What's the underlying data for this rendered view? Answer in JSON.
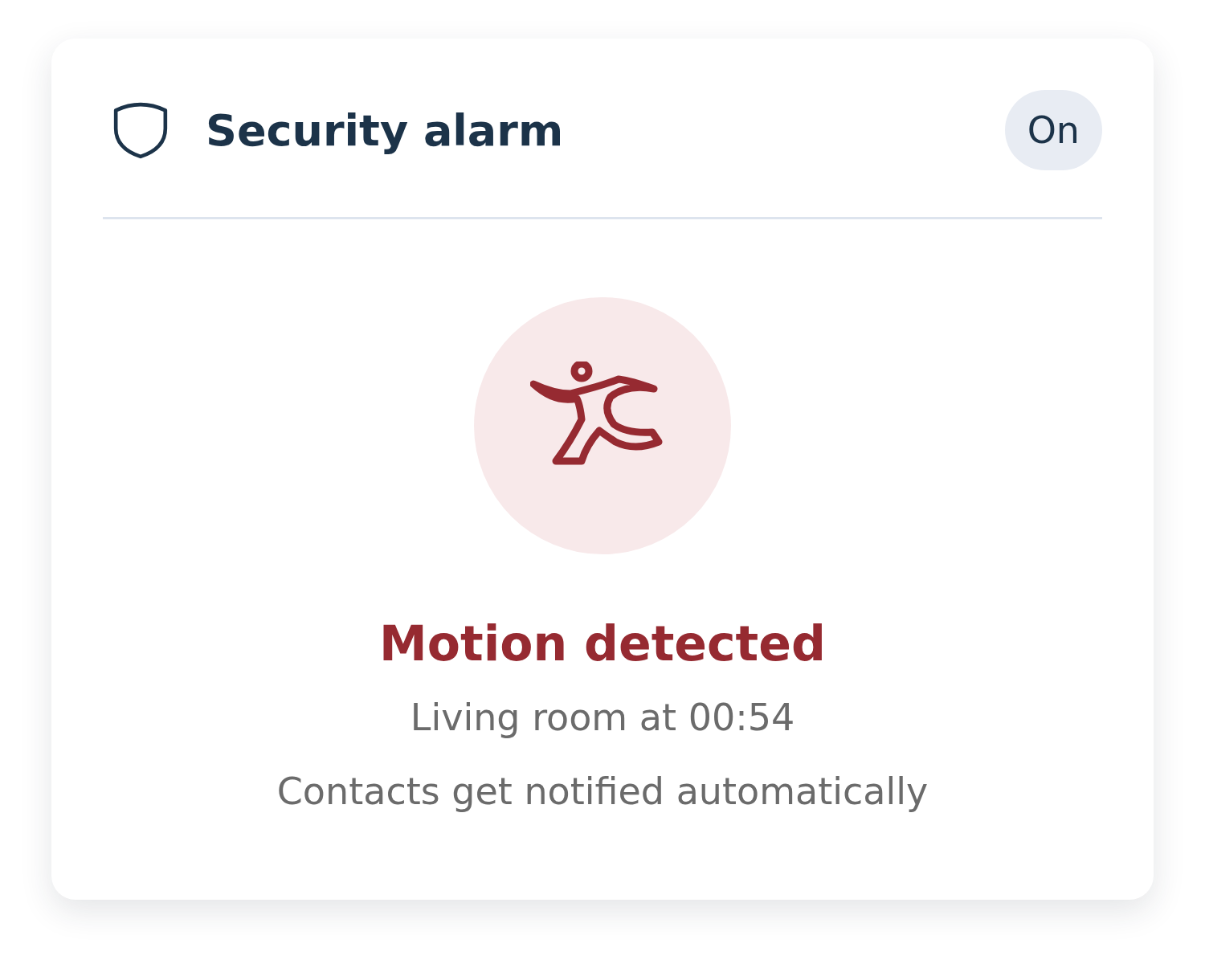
{
  "card": {
    "title": "Security alarm",
    "status_badge": "On",
    "alert": {
      "title": "Motion detected",
      "detail": "Living room at 00:54",
      "note": "Contacts get notified automatically"
    }
  }
}
